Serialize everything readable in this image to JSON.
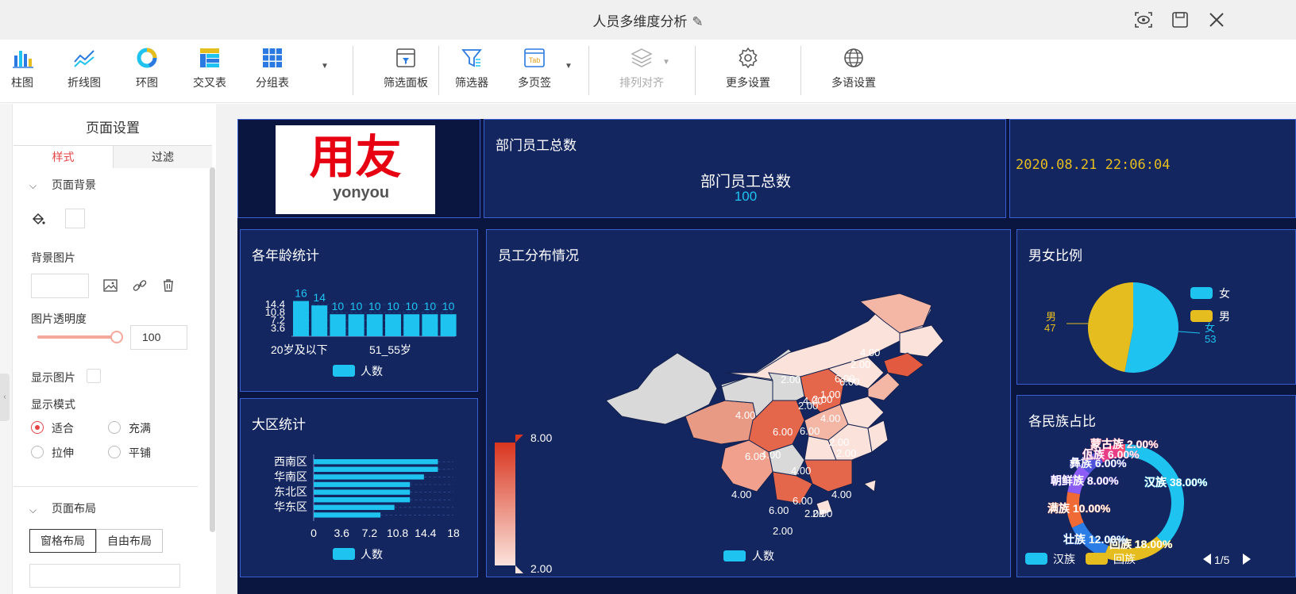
{
  "window": {
    "title": "人员多维度分析"
  },
  "toolbar": {
    "items": [
      {
        "label": "柱图",
        "icon": "bar-chart-icon"
      },
      {
        "label": "折线图",
        "icon": "line-chart-icon"
      },
      {
        "label": "环图",
        "icon": "ring-chart-icon"
      },
      {
        "label": "交叉表",
        "icon": "cross-table-icon"
      },
      {
        "label": "分组表",
        "icon": "group-table-icon"
      },
      {
        "label": "筛选面板",
        "icon": "filter-panel-icon"
      },
      {
        "label": "筛选器",
        "icon": "filter-icon"
      },
      {
        "label": "多页签",
        "icon": "tab-icon",
        "badge": "Tab"
      },
      {
        "label": "排列对齐",
        "icon": "align-layers-icon",
        "disabled": true
      },
      {
        "label": "更多设置",
        "icon": "gear-icon"
      },
      {
        "label": "多语设置",
        "icon": "globe-icon"
      }
    ]
  },
  "panel": {
    "title": "页面设置",
    "tabs": [
      "样式",
      "过滤"
    ],
    "background_section": "页面背景",
    "bg_image_label": "背景图片",
    "opacity_label": "图片透明度",
    "opacity_value": "100",
    "opacity_fraction": 1.0,
    "show_image_label": "显示图片",
    "display_mode_label": "显示模式",
    "modes": [
      "适合",
      "充满",
      "拉伸",
      "平铺"
    ],
    "selected_mode": "适合",
    "layout_section": "页面布局",
    "layout_buttons": [
      "窗格布局",
      "自由布局"
    ]
  },
  "dashboard": {
    "logo": {
      "brand": "用友",
      "sub": "yonyou"
    },
    "total": {
      "title": "部门员工总数",
      "label": "部门员工总数",
      "value": "100"
    },
    "datetime": "2020.08.21 22:06:04",
    "age_card": {
      "title": "各年龄统计",
      "legend": "人数"
    },
    "region_card": {
      "title": "大区统计",
      "legend": "人数"
    },
    "map_card": {
      "title": "员工分布情况",
      "legend": "人数",
      "scale_max": "8.00",
      "scale_min": "2.00",
      "labels": [
        "4.00",
        "2.00",
        "6.00",
        "2.00",
        "4.00",
        "2.00",
        "1.00",
        "4.00",
        "2.00",
        "6.00",
        "6.00",
        "4.00",
        "6.00",
        "2.00",
        "2.00",
        "6.00",
        "4.00",
        "4.00",
        "4.00",
        "6.00",
        "2.00",
        "6.00",
        "2.00",
        "2.00",
        "4.00"
      ]
    },
    "gender_card": {
      "title": "男女比例"
    },
    "ethnic_card": {
      "title": "各民族占比",
      "pager": "1/5"
    }
  },
  "chart_data": [
    {
      "type": "bar",
      "title": "各年龄统计",
      "categories_shown": [
        "20岁及以下",
        "51_55岁"
      ],
      "values": [
        16,
        14,
        10,
        10,
        10,
        10,
        10,
        10,
        10
      ],
      "yticks": [
        "3.6",
        "7.2",
        "10.8",
        "14.4"
      ],
      "series": [
        {
          "name": "人数",
          "values": [
            16,
            14,
            10,
            10,
            10,
            10,
            10,
            10,
            10
          ]
        }
      ]
    },
    {
      "type": "bar",
      "orientation": "horizontal",
      "title": "大区统计",
      "categories_shown": [
        "西南区",
        "华南区",
        "东北区",
        "华东区"
      ],
      "values": [
        16,
        16,
        14.2,
        12.4,
        12.4,
        12.4,
        10.4,
        8.6
      ],
      "xticks": [
        "0",
        "3.6",
        "7.2",
        "10.8",
        "14.4",
        "18"
      ],
      "xlim": [
        0,
        18
      ],
      "series": [
        {
          "name": "人数",
          "values": [
            16,
            16,
            14.2,
            12.4,
            12.4,
            12.4,
            10.4,
            8.6
          ]
        }
      ]
    },
    {
      "type": "pie",
      "title": "男女比例",
      "slices": [
        {
          "name": "女",
          "value": 53,
          "color": "#1ec3f0"
        },
        {
          "name": "男",
          "value": 47,
          "color": "#e6bd1f"
        }
      ]
    },
    {
      "type": "pie",
      "title": "各民族占比",
      "donut": true,
      "slices": [
        {
          "name": "汉族",
          "value": 38.0,
          "label": "汉族 38.00%",
          "color": "#1ec3f0"
        },
        {
          "name": "回族",
          "value": 18.0,
          "label": "回族 18.00%",
          "color": "#e6bd1f"
        },
        {
          "name": "壮族",
          "value": 12.0,
          "label": "壮族 12.00%",
          "color": "#2d7de6"
        },
        {
          "name": "满族",
          "value": 10.0,
          "label": "满族 10.00%",
          "color": "#f06a36"
        },
        {
          "name": "朝鲜族",
          "value": 8.0,
          "label": "朝鲜族 8.00%",
          "color": "#8b5cf6"
        },
        {
          "name": "彝族",
          "value": 6.0,
          "label": "彝族 6.00%",
          "color": "#4e54d9"
        },
        {
          "name": "佤族",
          "value": 6.0,
          "label": "佤族 6.00%",
          "color": "#e93d86"
        },
        {
          "name": "蒙古族",
          "value": 2.0,
          "label": "蒙古族 2.00%",
          "color": "#ff4d6d"
        }
      ],
      "legend_shown": [
        "汉族",
        "回族"
      ]
    }
  ],
  "colors": {
    "accent": "#e64545",
    "dash_bg": "#0a1640",
    "card_bg": "#132660",
    "card_border": "#3b5fd1",
    "cyan": "#1ec3f0",
    "gold": "#e6bd1f"
  }
}
